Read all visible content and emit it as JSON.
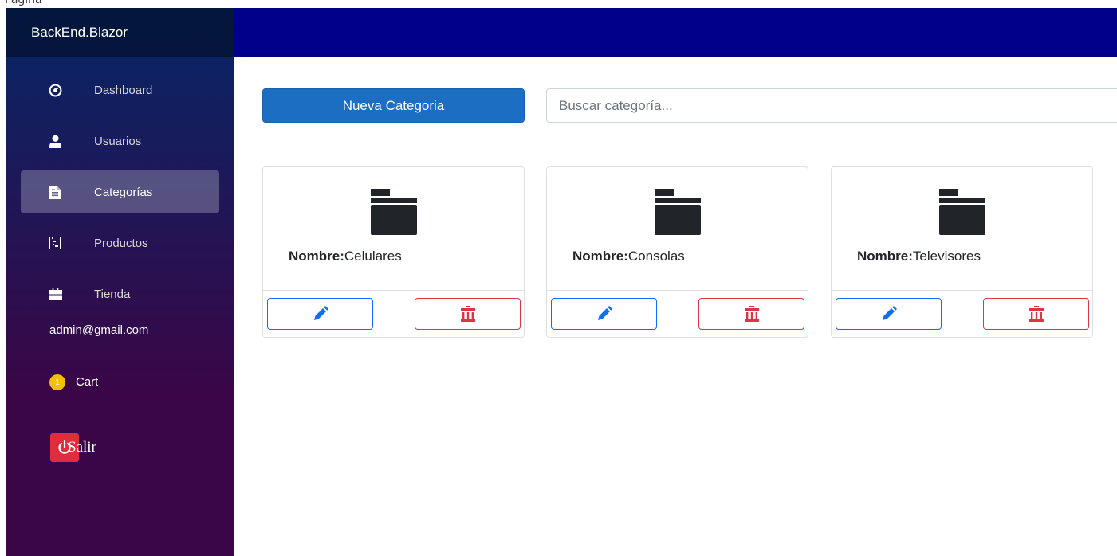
{
  "app": {
    "top_label": "Pagina",
    "brand": "BackEnd.Blazor"
  },
  "sidebar": {
    "items": [
      {
        "label": "Dashboard",
        "icon": "dashboard-icon",
        "active": false
      },
      {
        "label": "Usuarios",
        "icon": "person-icon",
        "active": false
      },
      {
        "label": "Categorías",
        "icon": "document-icon",
        "active": true
      },
      {
        "label": "Productos",
        "icon": "list-icon",
        "active": false
      },
      {
        "label": "Tienda",
        "icon": "briefcase-icon",
        "active": false
      }
    ],
    "email": "admin@gmail.com",
    "cart": {
      "count": "1",
      "label": "Cart"
    },
    "logout_label": "Salir"
  },
  "toolbar": {
    "new_button_label": "Nueva Categoria",
    "search_placeholder": "Buscar categoría..."
  },
  "cards": [
    {
      "name_label": "Nombre:",
      "name_value": "Celulares"
    },
    {
      "name_label": "Nombre:",
      "name_value": "Consolas"
    },
    {
      "name_label": "Nombre:",
      "name_value": "Televisores"
    }
  ],
  "colors": {
    "topbar": "#00008b",
    "primary": "#1b6ec2",
    "danger": "#dc3545",
    "edit_border": "#0d6efd",
    "badge": "#f5c000",
    "logout": "#e02c3b"
  }
}
